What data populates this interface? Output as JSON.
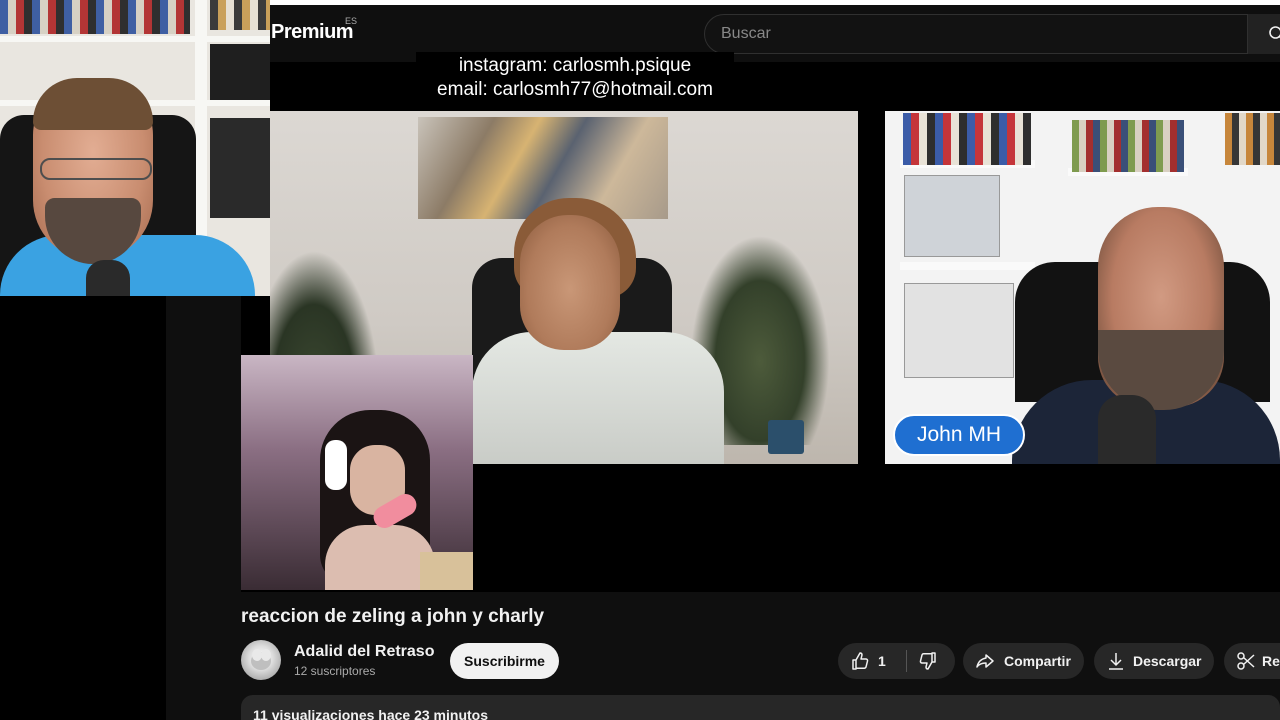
{
  "header": {
    "logo_text": "Premium",
    "logo_country": "ES",
    "search_placeholder": "Buscar",
    "search_icon": "search-icon"
  },
  "player": {
    "caption_line1": "instagram: carlosmh.psique",
    "caption_line2": "email: carlosmh77@hotmail.com",
    "name_tag": "John MH"
  },
  "video": {
    "title": "reaccion de zeling a john y charly"
  },
  "channel": {
    "name": "Adalid del Retraso",
    "subscribers": "12 suscriptores",
    "subscribe_label": "Suscribirme"
  },
  "actions": {
    "like_count": "1",
    "share_label": "Compartir",
    "download_label": "Descargar",
    "clip_label": "Re"
  },
  "description": {
    "stats": "11 visualizaciones  hace 23 minutos"
  },
  "colors": {
    "background": "#0f0f0f",
    "pill": "#272727",
    "subscribe": "#f1f1f1",
    "name_tag": "#1f6fd1",
    "webcam_shirt": "#3aa2e2"
  }
}
